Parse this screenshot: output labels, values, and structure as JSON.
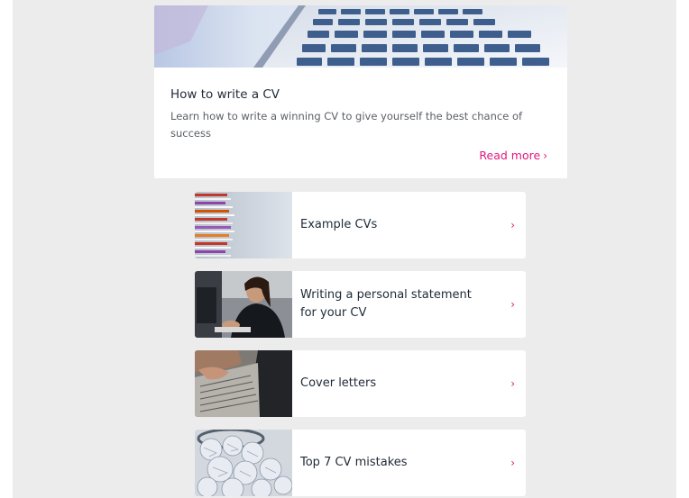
{
  "hero": {
    "title": "How to write a CV",
    "description": "Learn how to write a winning CV to give yourself the best chance of success",
    "read_more": "Read more",
    "read_more_chevron": "›",
    "image_icon": "laptop-keyboard-image"
  },
  "links": [
    {
      "label": "Example CVs",
      "chevron": "›",
      "thumb": "paper-stack-image"
    },
    {
      "label": "Writing a personal statement for your CV",
      "chevron": "›",
      "thumb": "woman-at-computer-image"
    },
    {
      "label": "Cover letters",
      "chevron": "›",
      "thumb": "typing-laptop-image"
    },
    {
      "label": "Top 7 CV mistakes",
      "chevron": "›",
      "thumb": "crumpled-paper-bin-image"
    }
  ],
  "colors": {
    "accent": "#e0197d",
    "page_background": "#ececec",
    "card_background": "#ffffff",
    "title_text": "#1f2a36"
  }
}
